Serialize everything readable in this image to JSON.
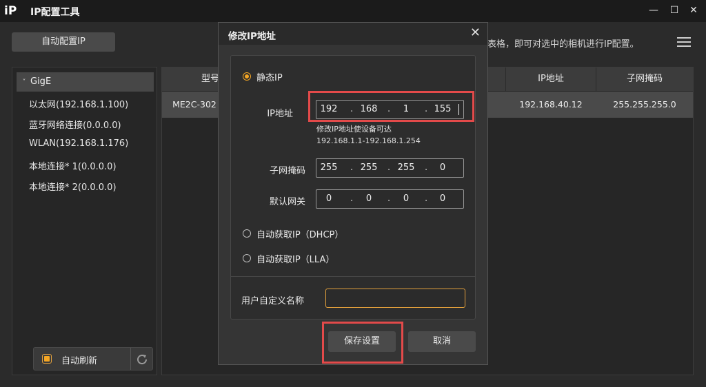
{
  "app": {
    "icon_text": "iP",
    "title": "IP配置工具"
  },
  "window_controls": {
    "minimize": "—",
    "maximize": "☐",
    "close": "✕"
  },
  "toolbar": {
    "auto_config_label": "自动配置IP",
    "hint": "表格，即可对选中的相机进行IP配置。"
  },
  "tree": {
    "root": "GigE",
    "items": [
      "以太网(192.168.1.100)",
      "蓝牙网络连接(0.0.0.0)",
      "WLAN(192.168.1.176)",
      "本地连接* 1(0.0.0.0)",
      "本地连接* 2(0.0.0.0)"
    ]
  },
  "auto_refresh": {
    "label": "自动刷新",
    "checked": true
  },
  "table": {
    "headers": [
      "型号",
      "IP地址",
      "子网掩码"
    ],
    "row": {
      "model": "ME2C-302",
      "ip": "192.168.40.12",
      "mask": "255.255.255.0"
    }
  },
  "dialog": {
    "title": "修改IP地址",
    "close": "✕",
    "static_ip_label": "静态IP",
    "ip_label": "IP地址",
    "ip": [
      "192",
      "168",
      "1",
      "155"
    ],
    "note_line1": "修改IP地址使设备可达",
    "note_line2": "192.168.1.1-192.168.1.254",
    "mask_label": "子网掩码",
    "mask": [
      "255",
      "255",
      "255",
      "0"
    ],
    "gateway_label": "默认网关",
    "gateway": [
      "0",
      "0",
      "0",
      "0"
    ],
    "dhcp_label": "自动获取IP（DHCP）",
    "lla_label": "自动获取IP（LLA）",
    "custom_name_label": "用户自定义名称",
    "custom_name_value": "",
    "save_label": "保存设置",
    "cancel_label": "取消"
  },
  "colors": {
    "accent": "#f5a623",
    "highlight": "#e34a4a",
    "background": "#2b2b2b"
  }
}
